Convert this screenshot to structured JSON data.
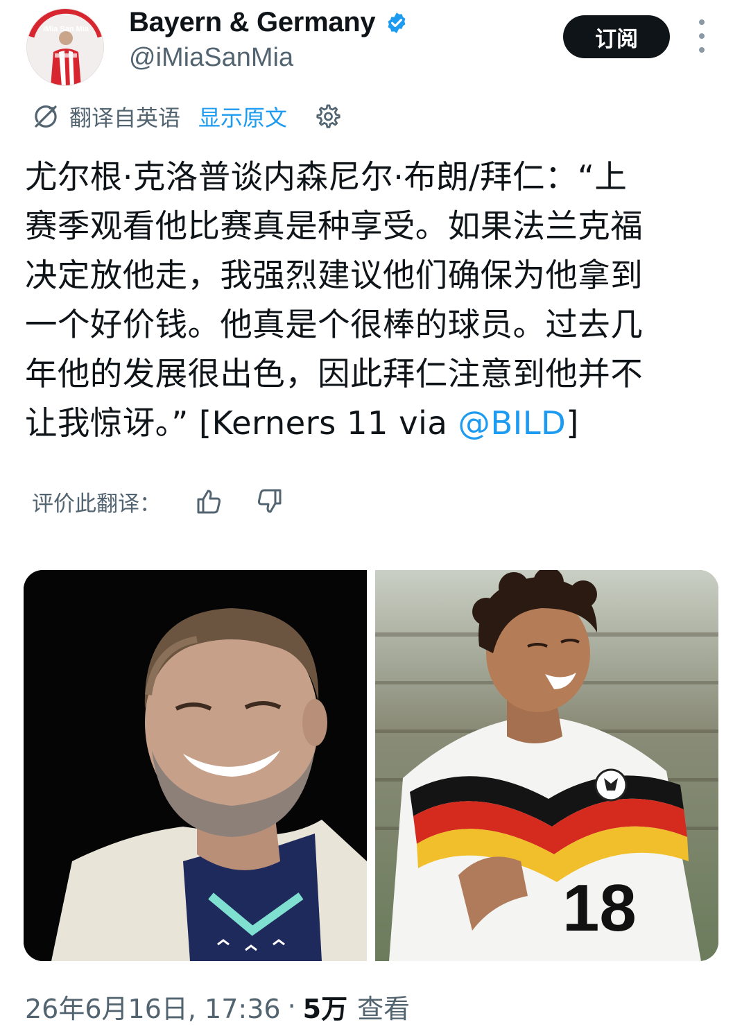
{
  "header": {
    "display_name": "Bayern & Germany",
    "handle": "@iMiaSanMia",
    "subscribe_label": "订阅",
    "avatar_text": "iMia San Mia"
  },
  "translation": {
    "translated_from": "翻译自英语",
    "show_original": "显示原文"
  },
  "tweet": {
    "lines": [
      "尤尔根·克洛普谈内森尼尔·布朗/拜仁：“上",
      "赛季观看他比赛真是种享受。如果法兰克福",
      "决定放他走，我强烈建议他们确保为他拿到",
      "一个好价钱。他真是个很棒的球员。过去几",
      "年他的发展很出色，因此拜仁注意到他并不"
    ],
    "last_line_prefix": "让我惊讶。” [Kerners 11 via ",
    "mention": "@BILD",
    "last_line_suffix": "]"
  },
  "rate": {
    "label": "评价此翻译："
  },
  "media": {
    "jersey_number": "18"
  },
  "footer": {
    "timestamp": "26年6月16日, 17:36",
    "separator": "·",
    "views_count": "5万",
    "views_label": "查看"
  },
  "colors": {
    "text": "#0f1419",
    "secondary": "#536471",
    "link": "#1d9bf0",
    "verified": "#1d9bf0",
    "button_bg": "#0f1419"
  },
  "icons": {
    "verified": "verified-badge-icon",
    "translate": "translate-icon",
    "settings": "gear-icon",
    "like": "thumbs-up-icon",
    "dislike": "thumbs-down-icon",
    "more": "more-vertical-icon"
  }
}
